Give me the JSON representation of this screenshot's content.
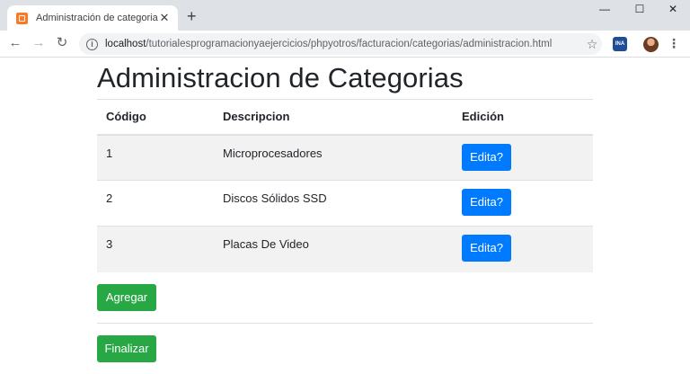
{
  "browser": {
    "tab_title": "Administración de categorias",
    "tab_close": "✕",
    "new_tab": "+",
    "url_host": "localhost",
    "url_path": "/tutorialesprogramacionyaejercicios/phpyotros/facturacion/categorias/administracion.html",
    "extension_label": "INA"
  },
  "page": {
    "title": "Administracion de Categorias",
    "table": {
      "headers": [
        "Código",
        "Descripcion",
        "Edición"
      ],
      "rows": [
        {
          "code": "1",
          "description": "Microprocesadores",
          "action": "Edita?"
        },
        {
          "code": "2",
          "description": "Discos Sólidos SSD",
          "action": "Edita?"
        },
        {
          "code": "3",
          "description": "Placas De Video",
          "action": "Edita?"
        }
      ]
    },
    "add_label": "Agregar",
    "finish_label": "Finalizar"
  },
  "colors": {
    "primary": "#007bff",
    "success": "#28a745",
    "favicon": "#fb7a24"
  }
}
